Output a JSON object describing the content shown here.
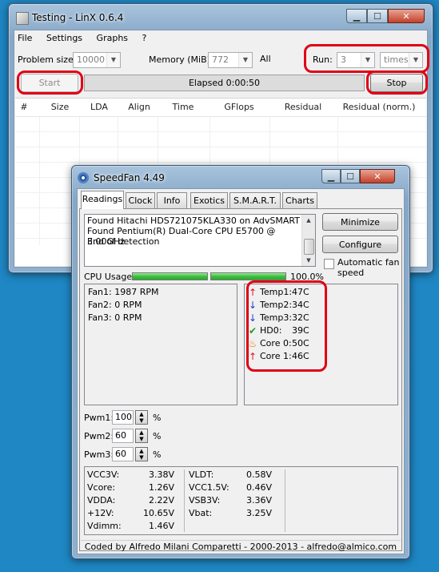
{
  "linx": {
    "title": "Testing - LinX 0.6.4",
    "menu": [
      "File",
      "Settings",
      "Graphs",
      "?"
    ],
    "problem_size_label": "Problem size:",
    "problem_size_value": "10000",
    "memory_label": "Memory (MiB):",
    "memory_value": "772",
    "memory_all": "All",
    "run_label": "Run:",
    "run_value": "3",
    "run_unit": "times",
    "start_label": "Start",
    "elapsed": "Elapsed 0:00:50",
    "stop_label": "Stop",
    "columns": [
      "#",
      "Size",
      "LDA",
      "Align",
      "Time",
      "GFlops",
      "Residual",
      "Residual (norm.)"
    ],
    "status_fragment": "3"
  },
  "speedfan": {
    "title": "SpeedFan 4.49",
    "tabs": [
      "Readings",
      "Clock",
      "Info",
      "Exotics",
      "S.M.A.R.T.",
      "Charts"
    ],
    "log_lines": [
      "Found Hitachi HDS721075KLA330 on AdvSMART",
      "Found Pentium(R) Dual-Core CPU E5700 @ 3.00GHz",
      "End of detection"
    ],
    "minimize_label": "Minimize",
    "configure_label": "Configure",
    "auto_fan_label": "Automatic fan speed",
    "cpu_usage_label": "CPU Usage",
    "cpu_usage_value": "100.0%",
    "cpu_core_loads": [
      100,
      100
    ],
    "fans": [
      "Fan1: 1987 RPM",
      "Fan2: 0 RPM",
      "Fan3: 0 RPM"
    ],
    "temps": [
      {
        "label": "Temp1:",
        "value": "47C",
        "icon": "arrow-up-icon",
        "color": "#e0141e"
      },
      {
        "label": "Temp2:",
        "value": "34C",
        "icon": "arrow-down-icon",
        "color": "#1a3fd0"
      },
      {
        "label": "Temp3:",
        "value": "32C",
        "icon": "arrow-down-icon",
        "color": "#1a3fd0"
      },
      {
        "label": "HD0:",
        "value": "39C",
        "icon": "checkmark-icon",
        "color": "#1e9e1e"
      },
      {
        "label": "Core 0:",
        "value": "50C",
        "icon": "flame-icon",
        "color": "#f07800"
      },
      {
        "label": "Core 1:",
        "value": "46C",
        "icon": "arrow-up-icon",
        "color": "#e0141e"
      }
    ],
    "pwm": [
      {
        "label": "Pwm1:",
        "value": "100",
        "unit": "%"
      },
      {
        "label": "Pwm2:",
        "value": "60",
        "unit": "%"
      },
      {
        "label": "Pwm3:",
        "value": "60",
        "unit": "%"
      }
    ],
    "voltages_left": [
      {
        "label": "VCC3V:",
        "value": "3.38V"
      },
      {
        "label": "Vcore:",
        "value": "1.26V"
      },
      {
        "label": "VDDA:",
        "value": "2.22V"
      },
      {
        "label": "+12V:",
        "value": "10.65V"
      },
      {
        "label": "Vdimm:",
        "value": "1.46V"
      }
    ],
    "voltages_right": [
      {
        "label": "VLDT:",
        "value": "0.58V"
      },
      {
        "label": "VCC1.5V:",
        "value": "0.46V"
      },
      {
        "label": "VSB3V:",
        "value": "3.36V"
      },
      {
        "label": "Vbat:",
        "value": "3.25V"
      }
    ],
    "footer": "Coded by Alfredo Milani Comparetti - 2000-2013 - alfredo@almico.com"
  },
  "colors": {
    "highlight": "#e00014",
    "desktop": "#1e87c4"
  }
}
